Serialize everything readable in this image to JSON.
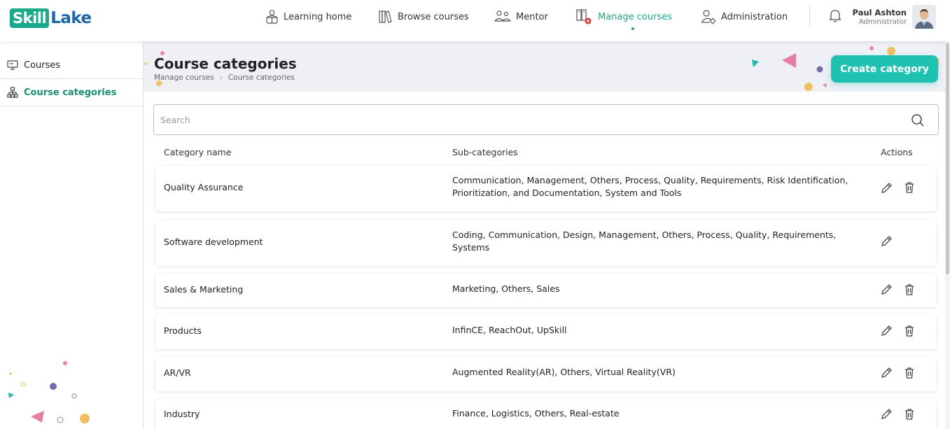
{
  "app": {
    "logo_part1": "Skill",
    "logo_part2": "Lake"
  },
  "nav": {
    "items": [
      {
        "label": "Learning home",
        "icon": "learning-home-icon"
      },
      {
        "label": "Browse courses",
        "icon": "books-icon"
      },
      {
        "label": "Mentor",
        "icon": "mentor-icon"
      },
      {
        "label": "Manage courses",
        "icon": "manage-courses-icon",
        "active": true
      },
      {
        "label": "Administration",
        "icon": "admin-user-gear-icon"
      }
    ]
  },
  "user": {
    "name": "Paul Ashton",
    "role": "Administrator"
  },
  "sidebar": {
    "items": [
      {
        "label": "Courses",
        "icon": "monitor-icon"
      },
      {
        "label": "Course categories",
        "icon": "hierarchy-icon",
        "active": true
      }
    ]
  },
  "page": {
    "title": "Course categories",
    "breadcrumb": [
      "Manage courses",
      "Course categories"
    ],
    "create_button": "Create category"
  },
  "search": {
    "placeholder": "Search",
    "value": ""
  },
  "table": {
    "headers": {
      "name": "Category name",
      "subs": "Sub-categories",
      "actions": "Actions"
    },
    "rows": [
      {
        "name": "Quality Assurance",
        "subs": "Communication, Management, Others, Process, Quality, Requirements, Risk Identification, Prioritization, and Documentation, System and Tools",
        "deletable": true
      },
      {
        "name": "Software development",
        "subs": "Coding, Communication, Design, Management, Others, Process, Quality, Requirements, Systems",
        "deletable": false
      },
      {
        "name": "Sales & Marketing",
        "subs": "Marketing, Others, Sales",
        "deletable": true
      },
      {
        "name": "Products",
        "subs": "InfinCE, ReachOut, UpSkill",
        "deletable": true
      },
      {
        "name": "AR/VR",
        "subs": "Augmented Reality(AR), Others, Virtual Reality(VR)",
        "deletable": true
      },
      {
        "name": "Industry",
        "subs": "Finance, Logistics, Others, Real-estate",
        "deletable": true
      }
    ]
  },
  "colors": {
    "accent": "#1aa98a",
    "button": "#1fc1b0",
    "banner": "#eef0f6",
    "logo_blue": "#1b66a8"
  }
}
